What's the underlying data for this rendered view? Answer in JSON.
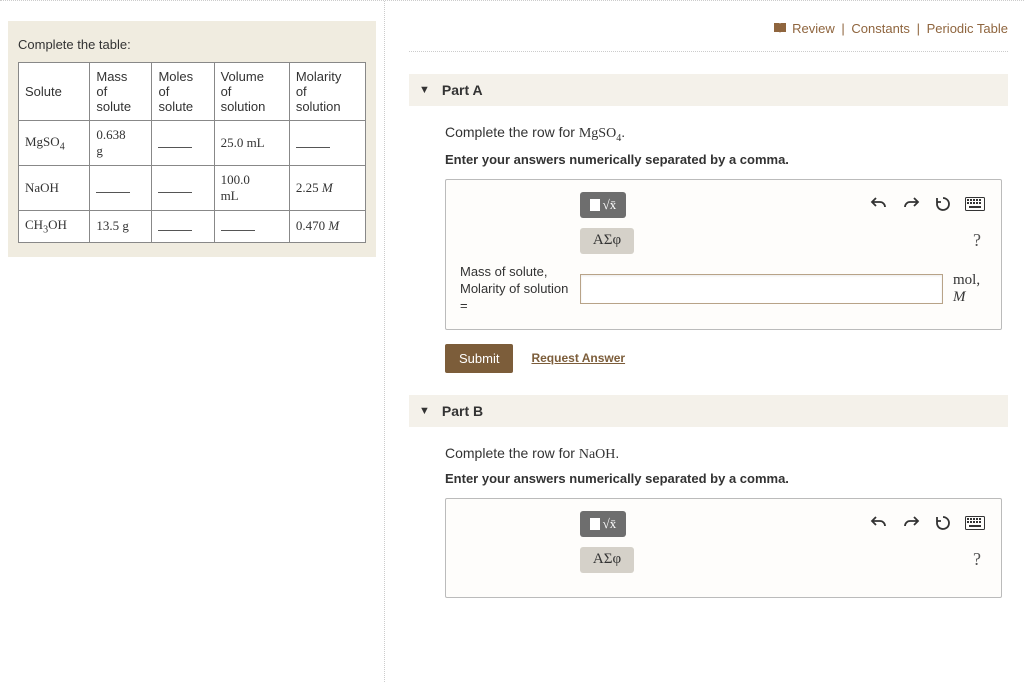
{
  "links": {
    "review": "Review",
    "constants": "Constants",
    "periodic": "Periodic Table"
  },
  "left": {
    "prompt": "Complete the table:",
    "headers": {
      "solute": "Solute",
      "mass": "Mass of solute",
      "moles": "Moles of solute",
      "volume": "Volume of solution",
      "molarity": "Molarity of solution"
    },
    "rows": [
      {
        "solute_html": "MgSO<sub>4</sub>",
        "mass": "0.638 g",
        "moles": "",
        "volume": "25.0 mL",
        "molarity": ""
      },
      {
        "solute_html": "NaOH",
        "mass": "",
        "moles": "",
        "volume": "100.0 mL",
        "molarity": "2.25 M"
      },
      {
        "solute_html": "CH<sub>3</sub>OH",
        "mass": "13.5 g",
        "moles": "",
        "volume": "",
        "molarity": "0.470 M"
      }
    ]
  },
  "partA": {
    "title": "Part A",
    "q1_pre": "Complete the row for ",
    "q1_chem": "MgSO₄",
    "q1_post": ".",
    "q2": "Enter your answers numerically separated by a comma.",
    "symbols": "ΑΣφ",
    "input_label": "Mass of solute, Molarity of solution =",
    "unit_html": "mol, <span class='it'>M</span>",
    "submit": "Submit",
    "request": "Request Answer"
  },
  "partB": {
    "title": "Part B",
    "q1_pre": "Complete the row for ",
    "q1_chem": "NaOH",
    "q1_post": ".",
    "q2": "Enter your answers numerically separated by a comma.",
    "symbols": "ΑΣφ"
  }
}
